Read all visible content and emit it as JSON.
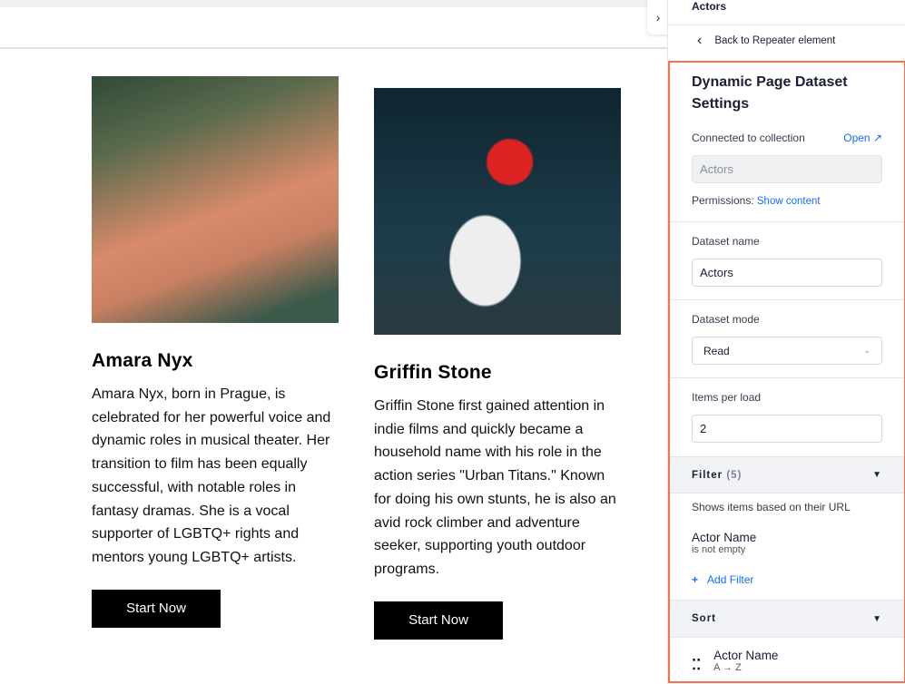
{
  "canvas": {
    "cards": [
      {
        "name": "Amara Nyx",
        "description": "Amara Nyx, born in Prague, is celebrated for her powerful voice and dynamic roles in musical theater. Her transition to film has been equally successful, with notable roles in fantasy dramas. She is a vocal supporter of LGBTQ+ rights and mentors young LGBTQ+ artists.",
        "button": "Start Now"
      },
      {
        "name": "Griffin Stone",
        "description": "Griffin Stone first gained attention in indie films and quickly became a household name with his role in the action series \"Urban Titans.\" Known for doing his own stunts, he is also an avid rock climber and adventure seeker, supporting youth outdoor programs.",
        "button": "Start Now"
      }
    ]
  },
  "panel": {
    "header": "Actors",
    "back": "Back to Repeater element",
    "title": "Dynamic Page Dataset Settings",
    "connected_label": "Connected to collection",
    "open_link": "Open",
    "collection_value": "Actors",
    "permissions_label": "Permissions:",
    "permissions_link": "Show content",
    "dataset_name_label": "Dataset name",
    "dataset_name_value": "Actors",
    "dataset_mode_label": "Dataset mode",
    "dataset_mode_value": "Read",
    "items_label": "Items per load",
    "items_value": "2",
    "filter_label": "Filter",
    "filter_count": "(5)",
    "filter_desc": "Shows items based on their URL",
    "filter_field": "Actor Name",
    "filter_condition": "is not empty",
    "add_filter": "Add Filter",
    "sort_label": "Sort",
    "sort_field": "Actor Name",
    "sort_order": "A → Z"
  },
  "colors": {
    "accent": "#116dff",
    "highlight": "#f5714f"
  }
}
